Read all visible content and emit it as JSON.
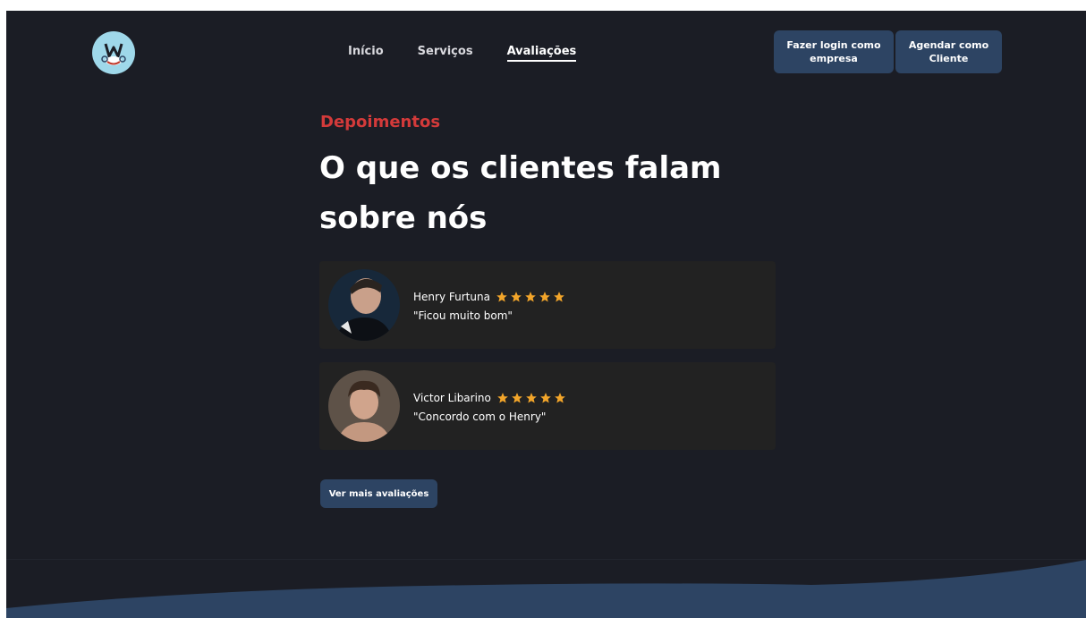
{
  "header": {
    "logo_icon": "barber-mascot-icon",
    "nav": [
      {
        "label": "Início",
        "active": false
      },
      {
        "label": "Serviços",
        "active": false
      },
      {
        "label": "Avaliações",
        "active": true
      }
    ],
    "login_button": {
      "line1": "Fazer login como",
      "line2": "empresa"
    },
    "schedule_button": {
      "line1": "Agendar como",
      "line2": "Cliente"
    }
  },
  "section": {
    "eyebrow": "Depoimentos",
    "title_line1": "O que os clientes falam",
    "title_line2": "sobre nós"
  },
  "reviews": [
    {
      "name": "Henry Furtuna",
      "rating": 5,
      "comment": "\"Ficou muito bom\""
    },
    {
      "name": "Victor Libarino",
      "rating": 5,
      "comment": "\"Concordo com o Henry\""
    }
  ],
  "more_button": "Ver mais avaliações",
  "colors": {
    "background": "#1b1d25",
    "accent_red": "#d33a3a",
    "button_blue": "#2d4463",
    "star": "#f2a52a",
    "card": "#222222",
    "wave": "#2d4463"
  }
}
